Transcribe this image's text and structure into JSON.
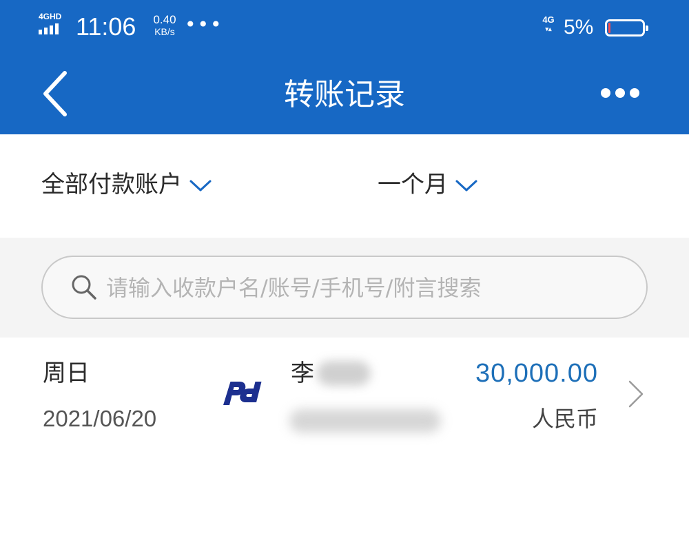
{
  "status_bar": {
    "network": "4GHD",
    "time": "11:06",
    "speed_value": "0.40",
    "speed_unit": "KB/s",
    "more_dots": "•••",
    "network_right": "4G",
    "battery_percent": "5%",
    "battery_level": 0.05
  },
  "header": {
    "title": "转账记录",
    "back_icon": "chevron-left-icon",
    "more_icon": "more-dots-icon",
    "background_color": "#1768c4"
  },
  "filters": {
    "account_label": "全部付款账户",
    "period_label": "一个月",
    "chevron_color": "#1768c4"
  },
  "search": {
    "placeholder": "请输入收款户名/账号/手机号/附言搜索"
  },
  "records": [
    {
      "weekday": "周日",
      "date": "2021/06/20",
      "bank_logo": "spdb-bank-logo",
      "payee_initial": "李",
      "amount": "30,000.00",
      "currency": "人民币",
      "amount_color": "#1d6fb8"
    }
  ]
}
